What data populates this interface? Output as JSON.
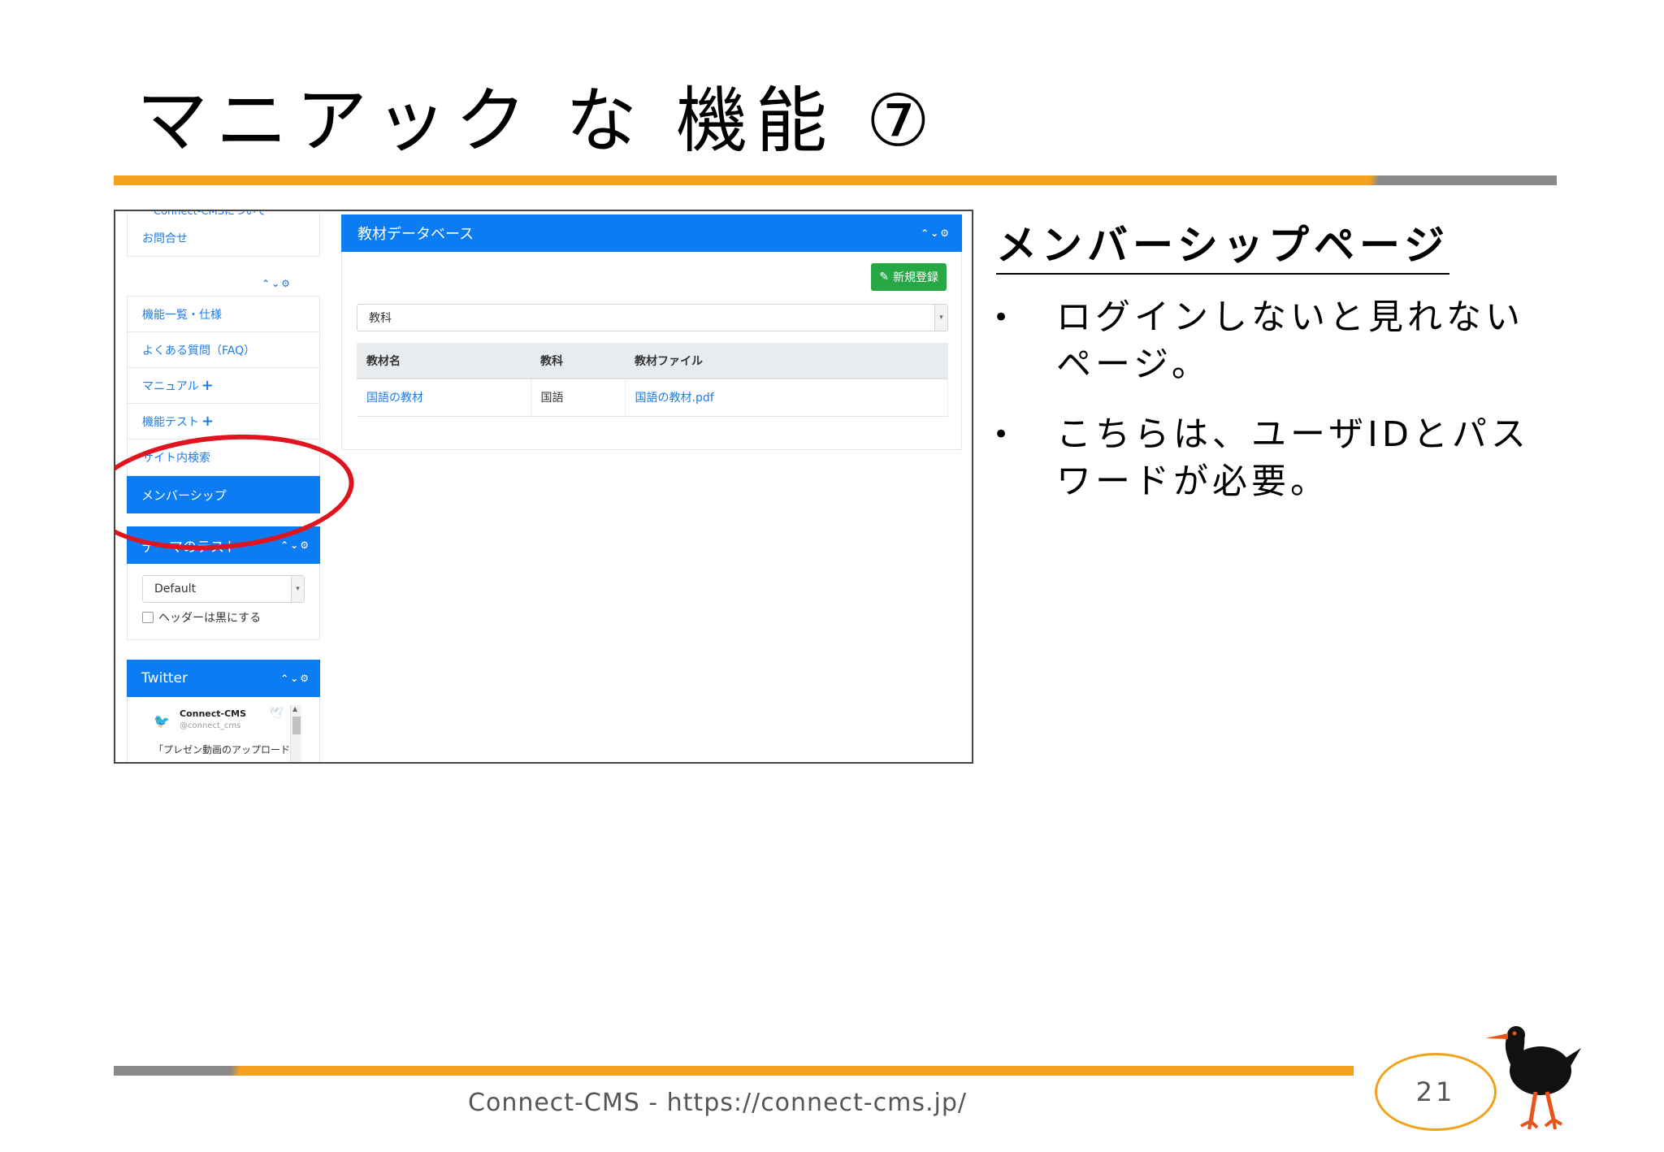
{
  "slide": {
    "title": "マニアック な 機能 ⑦",
    "footer": "Connect-CMS - https://connect-cms.jp/",
    "page_number": "21"
  },
  "screenshot": {
    "sidebar": {
      "cut_item": "Connect-CMSについて",
      "contact": "お問合せ",
      "nav_items": [
        {
          "label": "機能一覧・仕様",
          "plus": ""
        },
        {
          "label": "よくある質問（FAQ）",
          "plus": ""
        },
        {
          "label": "マニュアル",
          "plus": "+"
        },
        {
          "label": "機能テスト",
          "plus": "+"
        },
        {
          "label": "サイト内検索",
          "plus": ""
        }
      ],
      "active_item": "メンバーシップ",
      "theme_header": "テーマのテスト",
      "theme_select": "Default",
      "theme_checkbox": "ヘッダーは黒にする",
      "twitter_header": "Twitter",
      "tweet_name": "Connect-CMS",
      "tweet_handle": "@connect_cms",
      "tweet_text": "「プレゼン動画のアップロード"
    },
    "main": {
      "header": "教材データベース",
      "new_button": "新規登録",
      "filter_select": "教科",
      "table": {
        "headers": [
          "教材名",
          "教科",
          "教材ファイル"
        ],
        "rows": [
          [
            "国語の教材",
            "国語",
            "国語の教材.pdf"
          ]
        ]
      }
    }
  },
  "explanation": {
    "heading": "メンバーシップページ",
    "bullets": [
      "ログインしないと見れないページ。",
      "こちらは、ユーザIDとパスワードが必要。"
    ]
  },
  "colors": {
    "accent_orange": "#f5a01e",
    "rule_gray": "#8a8a8a",
    "ui_blue": "#0b7cf2",
    "ui_green": "#28a745",
    "highlight_red": "#e0141e"
  }
}
